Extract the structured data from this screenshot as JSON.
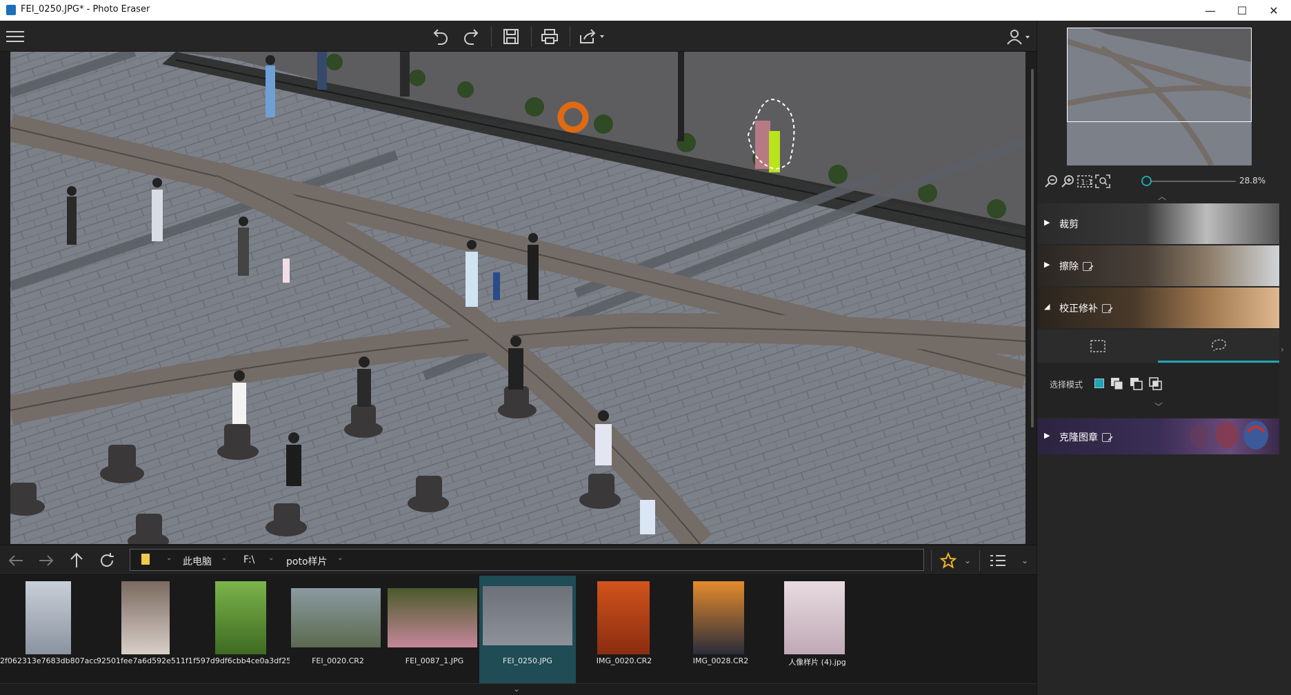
{
  "window": {
    "title": "FEI_0250.JPG* - Photo Eraser",
    "minimize": "—",
    "maximize": "☐",
    "close": "✕"
  },
  "toolbar": {
    "menu_icon": "hamburger-icon",
    "undo_icon": "undo-icon",
    "redo_icon": "redo-icon",
    "save_icon": "save-icon",
    "print_icon": "print-icon",
    "share_icon": "share-icon",
    "user_icon": "user-icon"
  },
  "navigator": {
    "zoom_value": "28.8%"
  },
  "panels": [
    {
      "label": "裁剪",
      "expanded": false
    },
    {
      "label": "擦除",
      "expanded": false
    },
    {
      "label": "校正修补",
      "expanded": true
    },
    {
      "label": "克隆图章",
      "expanded": false
    }
  ],
  "selection": {
    "mode_label": "选择模式",
    "tabs": [
      "rect-select",
      "lasso-select"
    ],
    "active_tab": "lasso-select",
    "accent": "#21a6b5"
  },
  "browser": {
    "path": [
      "此电脑",
      "F:\\",
      "poto样片"
    ],
    "star_color": "#f0b429"
  },
  "thumbnails": [
    {
      "name": "2f062313e7683db807acd...",
      "selected": false
    },
    {
      "name": "92501fee7a6d592e511f1...",
      "selected": false
    },
    {
      "name": "f597d9df6cbb4ce0a3df25...",
      "selected": false
    },
    {
      "name": "FEI_0020.CR2",
      "selected": false
    },
    {
      "name": "FEI_0087_1.JPG",
      "selected": false
    },
    {
      "name": "FEI_0250.JPG",
      "selected": true
    },
    {
      "name": "IMG_0020.CR2",
      "selected": false
    },
    {
      "name": "IMG_0028.CR2",
      "selected": false
    },
    {
      "name": "人像样片 (4).jpg",
      "selected": false
    }
  ]
}
